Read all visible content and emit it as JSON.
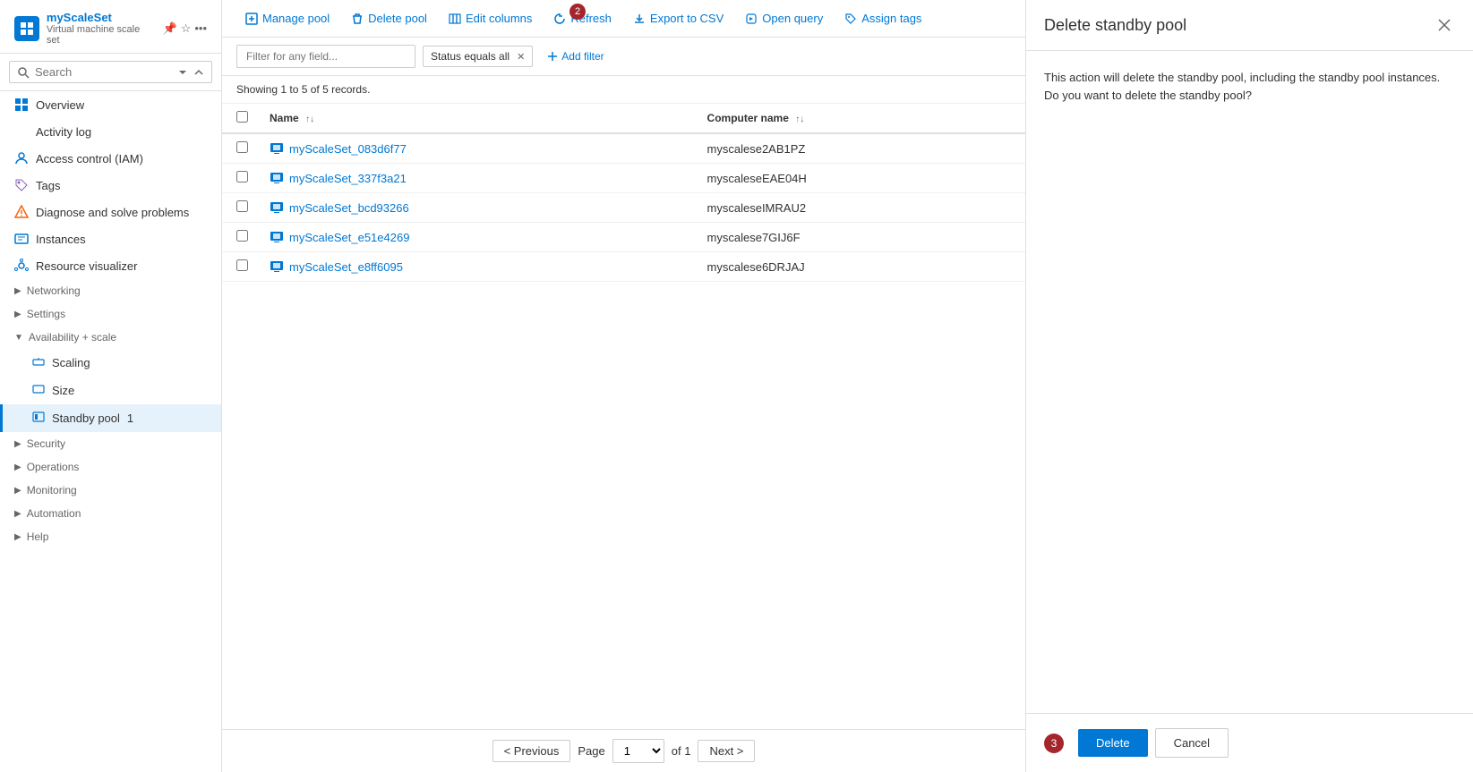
{
  "app": {
    "title": "myScaleSet",
    "section": "Standby pool",
    "subtitle": "Virtual machine scale set"
  },
  "sidebar": {
    "search_placeholder": "Search",
    "nav_items": [
      {
        "id": "overview",
        "label": "Overview",
        "icon": "overview-icon",
        "indent": 0
      },
      {
        "id": "activity-log",
        "label": "Activity log",
        "icon": "activity-icon",
        "indent": 0
      },
      {
        "id": "iam",
        "label": "Access control (IAM)",
        "icon": "iam-icon",
        "indent": 0
      },
      {
        "id": "tags",
        "label": "Tags",
        "icon": "tags-icon",
        "indent": 0
      },
      {
        "id": "diagnose",
        "label": "Diagnose and solve problems",
        "icon": "diagnose-icon",
        "indent": 0
      },
      {
        "id": "instances",
        "label": "Instances",
        "icon": "instances-icon",
        "indent": 0
      },
      {
        "id": "resource-visualizer",
        "label": "Resource visualizer",
        "icon": "visualizer-icon",
        "indent": 0
      },
      {
        "id": "networking",
        "label": "Networking",
        "icon": "networking-icon",
        "indent": 0,
        "group": true
      },
      {
        "id": "settings",
        "label": "Settings",
        "icon": "settings-icon",
        "indent": 0,
        "group": true
      },
      {
        "id": "availability-scale",
        "label": "Availability + scale",
        "icon": "availability-icon",
        "indent": 0,
        "group": true,
        "expanded": true
      },
      {
        "id": "scaling",
        "label": "Scaling",
        "icon": "scaling-icon",
        "indent": 1
      },
      {
        "id": "size",
        "label": "Size",
        "icon": "size-icon",
        "indent": 1
      },
      {
        "id": "standby-pool",
        "label": "Standby pool",
        "icon": "standby-icon",
        "indent": 1,
        "active": true,
        "badge": "1"
      },
      {
        "id": "security",
        "label": "Security",
        "icon": "security-icon",
        "indent": 0,
        "group": true
      },
      {
        "id": "operations",
        "label": "Operations",
        "icon": "operations-icon",
        "indent": 0,
        "group": true
      },
      {
        "id": "monitoring",
        "label": "Monitoring",
        "icon": "monitoring-icon",
        "indent": 0,
        "group": true
      },
      {
        "id": "automation",
        "label": "Automation",
        "icon": "automation-icon",
        "indent": 0,
        "group": true
      },
      {
        "id": "help",
        "label": "Help",
        "icon": "help-icon",
        "indent": 0,
        "group": true
      }
    ]
  },
  "toolbar": {
    "manage_pool_label": "Manage pool",
    "delete_pool_label": "Delete pool",
    "edit_columns_label": "Edit columns",
    "refresh_label": "Refresh",
    "export_csv_label": "Export to CSV",
    "open_query_label": "Open query",
    "assign_tags_label": "Assign tags",
    "toolbar_badge": "2"
  },
  "filter": {
    "placeholder": "Filter for any field...",
    "status_filter": "Status equals all",
    "add_filter_label": "Add filter"
  },
  "records": {
    "summary": "Showing 1 to 5 of 5 records."
  },
  "table": {
    "col_name": "Name",
    "col_computer_name": "Computer name",
    "rows": [
      {
        "name": "myScaleSet_083d6f77",
        "computer_name": "myscalese2AB1PZ"
      },
      {
        "name": "myScaleSet_337f3a21",
        "computer_name": "myscaleseEAE04H"
      },
      {
        "name": "myScaleSet_bcd93266",
        "computer_name": "myscaleseIMRAU2"
      },
      {
        "name": "myScaleSet_e51e4269",
        "computer_name": "myscalese7GIJ6F"
      },
      {
        "name": "myScaleSet_e8ff6095",
        "computer_name": "myscalese6DRJAJ"
      }
    ]
  },
  "pagination": {
    "previous_label": "< Previous",
    "next_label": "Next >",
    "page_label": "Page",
    "of_label": "of 1",
    "page_value": "1"
  },
  "delete_panel": {
    "title": "Delete standby pool",
    "description": "This action will delete the standby pool, including the standby pool instances. Do you want to delete the standby pool?",
    "delete_label": "Delete",
    "cancel_label": "Cancel",
    "badge": "3"
  }
}
